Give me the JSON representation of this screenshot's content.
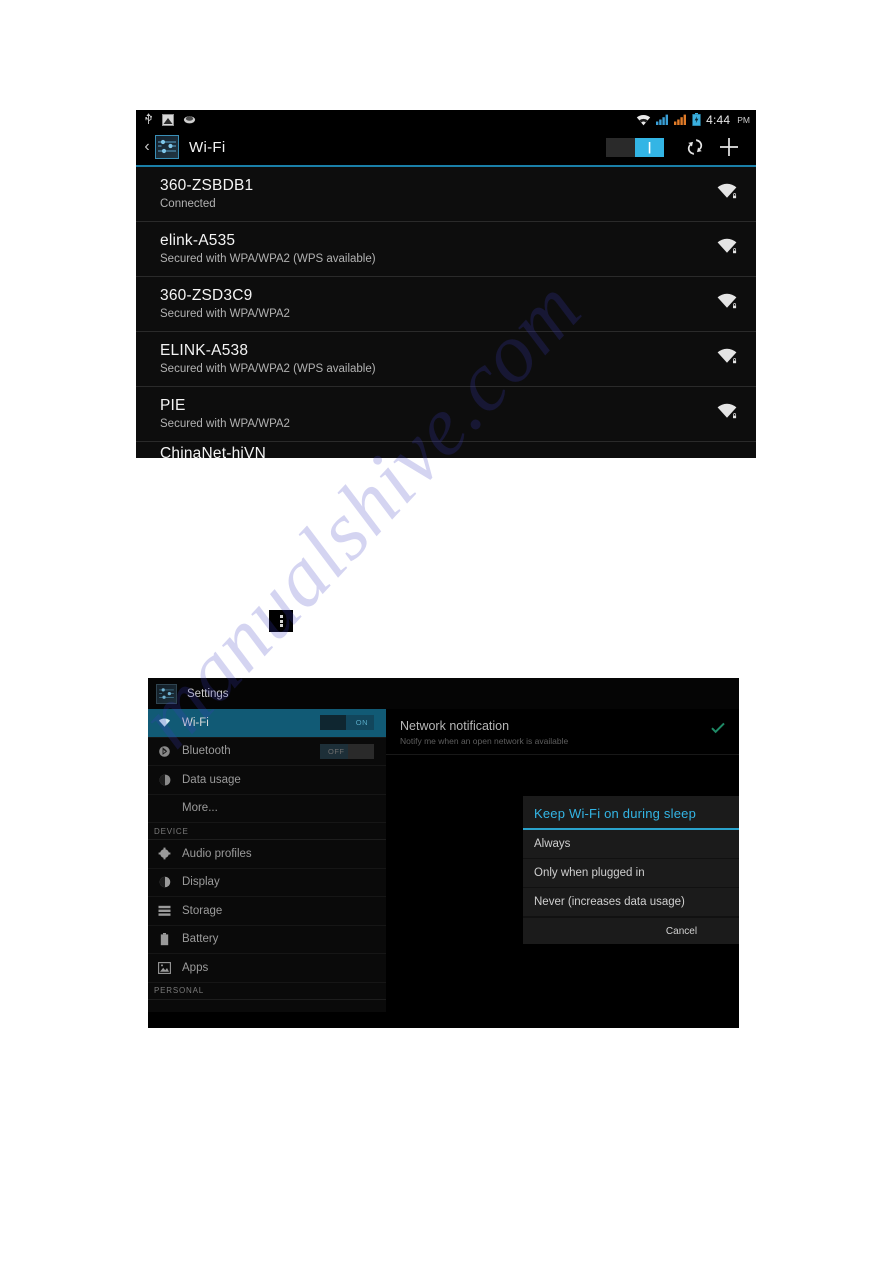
{
  "watermark": {
    "text": "manualshive.com"
  },
  "overflow_menu": {
    "icon": "overflow-menu-icon"
  },
  "wifi_screen": {
    "statusbar": {
      "left_icons": [
        "usb-icon",
        "screenshot-icon",
        "download-icon"
      ],
      "right_icons": [
        "wifi-signal-icon",
        "cellular-signal-1-icon",
        "cellular-signal-2-icon",
        "battery-charging-icon"
      ],
      "time": "4:44",
      "ampm": "PM"
    },
    "actionbar": {
      "back_glyph": "‹",
      "app_icon": "settings-icon",
      "title": "Wi-Fi",
      "switch_state": "ON",
      "switch_on_glyph": "|",
      "scan_icon": "scan-refresh-icon",
      "add_icon": "add-network-icon"
    },
    "networks": [
      {
        "ssid": "360-ZSBDB1",
        "status": "Connected",
        "signal_icon": "wifi-secured-icon"
      },
      {
        "ssid": "elink-A535",
        "status": "Secured with WPA/WPA2 (WPS available)",
        "signal_icon": "wifi-secured-icon"
      },
      {
        "ssid": "360-ZSD3C9",
        "status": "Secured with WPA/WPA2",
        "signal_icon": "wifi-secured-icon"
      },
      {
        "ssid": "ELINK-A538",
        "status": "Secured with WPA/WPA2 (WPS available)",
        "signal_icon": "wifi-secured-icon"
      },
      {
        "ssid": "PIE",
        "status": "Secured with WPA/WPA2",
        "signal_icon": "wifi-secured-icon"
      }
    ],
    "partial_network": {
      "ssid": "ChinaNet-hiVN"
    }
  },
  "settings_screen": {
    "window_title": "Settings",
    "app_icon": "settings-icon",
    "sidebar": [
      {
        "label": "Wi-Fi",
        "icon": "wifi-icon",
        "selected": true,
        "toggle": "ON",
        "toggle_state": "on"
      },
      {
        "label": "Bluetooth",
        "icon": "bluetooth-icon",
        "selected": false,
        "toggle": "OFF",
        "toggle_state": "off"
      },
      {
        "label": "Data usage",
        "icon": "data-usage-icon",
        "selected": false
      },
      {
        "label": "More...",
        "icon": "",
        "selected": false,
        "indent": true
      }
    ],
    "section_device": "DEVICE",
    "device_items": [
      {
        "label": "Audio profiles",
        "icon": "audio-profiles-icon"
      },
      {
        "label": "Display",
        "icon": "display-icon"
      },
      {
        "label": "Storage",
        "icon": "storage-icon"
      },
      {
        "label": "Battery",
        "icon": "battery-icon"
      },
      {
        "label": "Apps",
        "icon": "apps-icon"
      }
    ],
    "section_personal": "PERSONAL",
    "preference": {
      "title": "Network notification",
      "subtitle": "Notify me when an open network is available",
      "checked_icon": "checkmark-icon"
    },
    "dialog": {
      "title": "Keep Wi-Fi on during sleep",
      "options": [
        {
          "label": "Always",
          "selected": true
        },
        {
          "label": "Only when plugged in",
          "selected": false
        },
        {
          "label": "Never (increases data usage)",
          "selected": false
        }
      ],
      "cancel_label": "Cancel"
    }
  },
  "colors": {
    "accent_blue": "#33b5e5",
    "selected_row": "#115a75",
    "check_green": "#1f7a5e",
    "signal_orange": "#e07b28",
    "page_background": "#ffffff"
  }
}
